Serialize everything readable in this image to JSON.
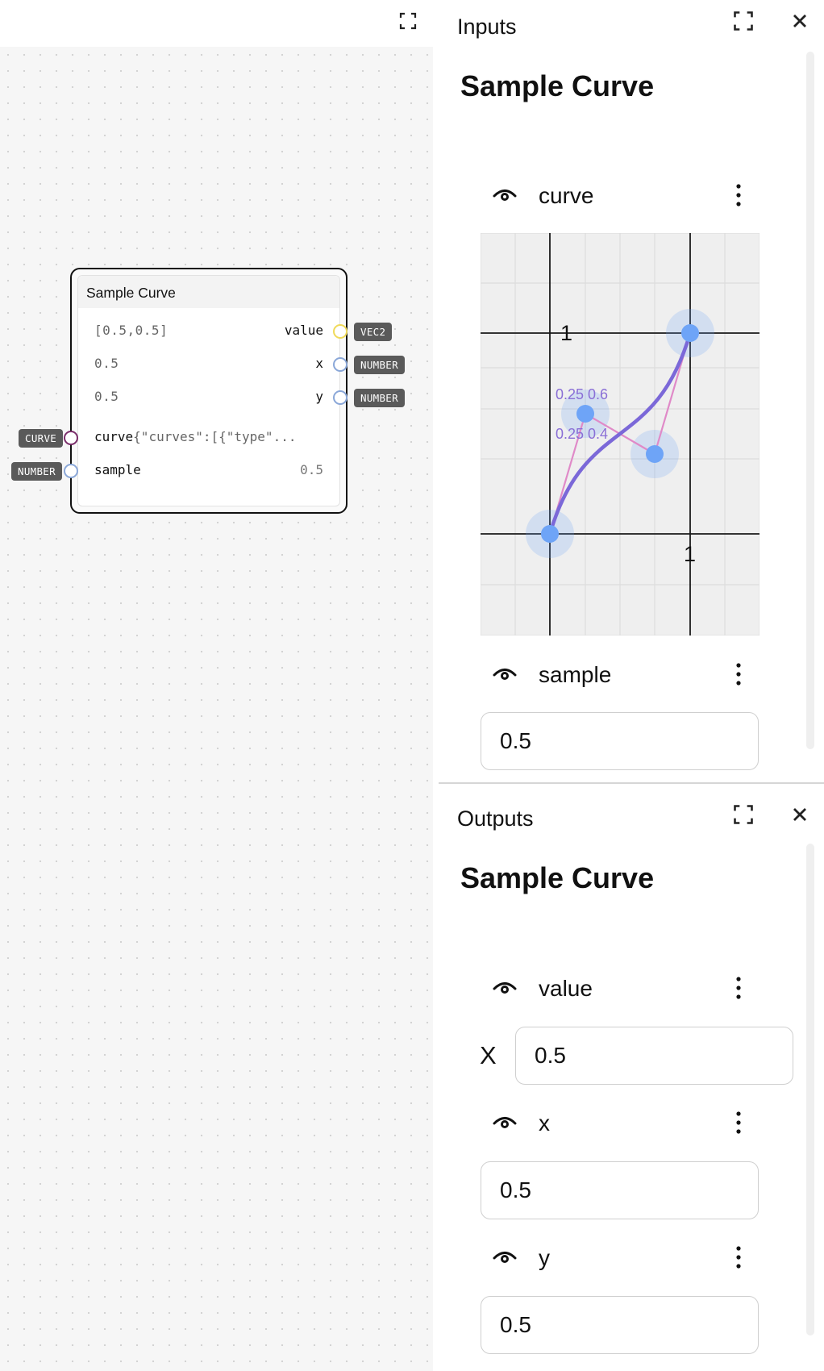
{
  "canvas": {
    "node": {
      "title": "Sample Curve",
      "outputs": [
        {
          "name": "value",
          "preview": "[0.5,0.5]",
          "type": "VEC2"
        },
        {
          "name": "x",
          "preview": "0.5",
          "type": "NUMBER"
        },
        {
          "name": "y",
          "preview": "0.5",
          "type": "NUMBER"
        }
      ],
      "inputs": [
        {
          "name": "curve",
          "preview": "{\"curves\":[{\"type\"...",
          "type": "CURVE"
        },
        {
          "name": "sample",
          "preview": "0.5",
          "type": "NUMBER"
        }
      ]
    }
  },
  "inputs_panel": {
    "title": "Inputs",
    "heading": "Sample Curve",
    "curve_field": {
      "label": "curve",
      "axis_labels": {
        "y_one": "1",
        "x_one": "1"
      },
      "point_labels": [
        "0.25 0.6",
        "0.25 0.4"
      ]
    },
    "sample_field": {
      "label": "sample",
      "value": "0.5"
    }
  },
  "outputs_panel": {
    "title": "Outputs",
    "heading": "Sample Curve",
    "value_field": {
      "label": "value",
      "x_label": "X",
      "x_value": "0.5"
    },
    "x_field": {
      "label": "x",
      "value": "0.5"
    },
    "y_field": {
      "label": "y",
      "value": "0.5"
    }
  },
  "colors": {
    "curve": "#7b68d8",
    "handle_line": "#e08ac8",
    "control_point": "#6ea4f7",
    "point_label": "#8a6fd6",
    "port_vec2": "#f0da5a",
    "port_number": "#8aa7d8",
    "port_curve": "#7a2d6a"
  },
  "icons": {
    "expand": "expand-icon",
    "close": "close-icon",
    "eye": "eye-icon",
    "more": "more-vertical-icon"
  }
}
